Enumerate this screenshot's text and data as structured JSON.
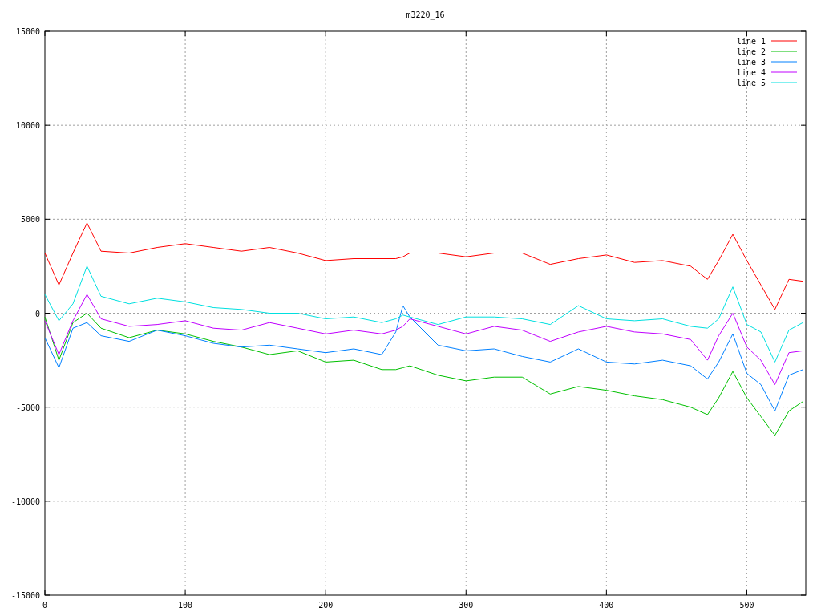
{
  "chart_data": {
    "type": "line",
    "title": "m3220_16",
    "x": [
      0,
      10,
      20,
      30,
      40,
      60,
      80,
      100,
      120,
      140,
      160,
      180,
      200,
      220,
      240,
      250,
      255,
      260,
      280,
      300,
      320,
      340,
      360,
      380,
      400,
      420,
      440,
      460,
      472,
      480,
      490,
      500,
      510,
      520,
      530,
      540
    ],
    "series": [
      {
        "name": "line 1",
        "color": "#ff0000",
        "values": [
          3200,
          1500,
          3200,
          4800,
          3300,
          3200,
          3500,
          3700,
          3500,
          3300,
          3500,
          3200,
          2800,
          2900,
          2900,
          2900,
          3000,
          3200,
          3200,
          3000,
          3200,
          3200,
          2600,
          2900,
          3100,
          2700,
          2800,
          2500,
          1800,
          2800,
          4200,
          2800,
          1500,
          200,
          1800,
          1700
        ]
      },
      {
        "name": "line 2",
        "color": "#00c000",
        "values": [
          -200,
          -2500,
          -500,
          0,
          -800,
          -1300,
          -900,
          -1100,
          -1500,
          -1800,
          -2200,
          -2000,
          -2600,
          -2500,
          -3000,
          -3000,
          -2900,
          -2800,
          -3300,
          -3600,
          -3400,
          -3400,
          -4300,
          -3900,
          -4100,
          -4400,
          -4600,
          -5000,
          -5400,
          -4500,
          -3100,
          -4500,
          -5500,
          -6500,
          -5200,
          -4700
        ]
      },
      {
        "name": "line 3",
        "color": "#0080ff",
        "values": [
          -1300,
          -2900,
          -800,
          -500,
          -1200,
          -1500,
          -900,
          -1200,
          -1600,
          -1800,
          -1700,
          -1900,
          -2100,
          -1900,
          -2200,
          -1000,
          400,
          -200,
          -1700,
          -2000,
          -1900,
          -2300,
          -2600,
          -1900,
          -2600,
          -2700,
          -2500,
          -2800,
          -3500,
          -2600,
          -1100,
          -3200,
          -3800,
          -5200,
          -3300,
          -3000
        ]
      },
      {
        "name": "line 4",
        "color": "#c000ff",
        "values": [
          -400,
          -2200,
          -400,
          1000,
          -300,
          -700,
          -600,
          -400,
          -800,
          -900,
          -500,
          -800,
          -1100,
          -900,
          -1100,
          -900,
          -700,
          -300,
          -700,
          -1100,
          -700,
          -900,
          -1500,
          -1000,
          -700,
          -1000,
          -1100,
          -1400,
          -2500,
          -1200,
          0,
          -1800,
          -2500,
          -3800,
          -2100,
          -2000
        ]
      },
      {
        "name": "line 5",
        "color": "#00e0e0",
        "values": [
          1000,
          -400,
          500,
          2500,
          900,
          500,
          800,
          600,
          300,
          200,
          0,
          0,
          -300,
          -200,
          -500,
          -300,
          -100,
          -200,
          -600,
          -200,
          -200,
          -300,
          -600,
          400,
          -300,
          -400,
          -300,
          -700,
          -800,
          -300,
          1400,
          -600,
          -1000,
          -2600,
          -900,
          -500
        ]
      }
    ],
    "xlim": [
      0,
      542
    ],
    "ylim": [
      -15000,
      15000
    ],
    "xticks": [
      0,
      100,
      200,
      300,
      400,
      500
    ],
    "yticks": [
      -15000,
      -10000,
      -5000,
      0,
      5000,
      10000,
      15000
    ],
    "grid": true,
    "legend": true
  }
}
